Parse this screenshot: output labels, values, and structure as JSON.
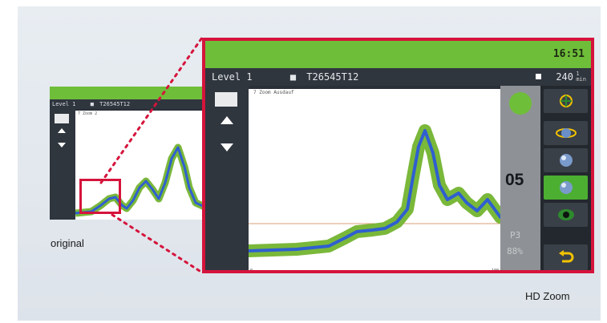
{
  "original": {
    "label": "original",
    "header": {
      "level": "Level 1",
      "id": "T26545T12"
    },
    "plot_label": "7 Zoom  2"
  },
  "zoom": {
    "label": "HD Zoom",
    "clock": "16:51",
    "header": {
      "level": "Level 1",
      "id": "T26545T12",
      "speed": "240"
    },
    "plot_label": "7 Zoom  Ausdauf",
    "counter": "05",
    "p_label": "P3",
    "percent": "88%",
    "axis_min": "0",
    "axis_max": "100"
  },
  "colors": {
    "accent_red": "#d5143c",
    "green": "#6fbe3a",
    "curve_blue": "#2f5fd0",
    "curve_green": "#7ab83a"
  },
  "icons": [
    "menu-icon",
    "arrow-up-icon",
    "arrow-down-icon",
    "target-icon",
    "rotate-icon",
    "sphere-icon",
    "sphere-down-icon",
    "eye-icon",
    "return-icon",
    "status-circle-icon",
    "printer-icon",
    "square-icon"
  ]
}
